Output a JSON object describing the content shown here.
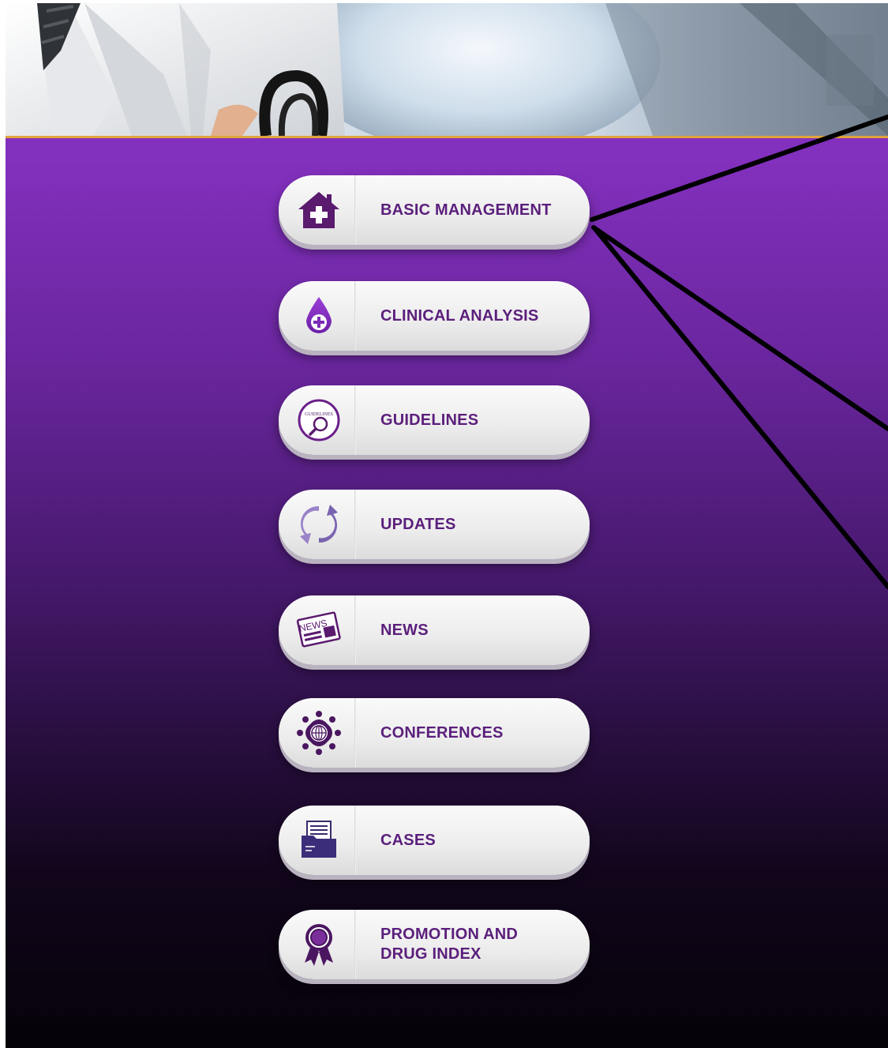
{
  "theme": {
    "accent": "#5b1f7c",
    "background_top": "#8a33c6",
    "background_bottom": "#050208",
    "header_border": "#e0a43a"
  },
  "hero": {
    "image": "doctor-with-stethoscope-photo"
  },
  "menu": {
    "items": [
      {
        "label": "BASIC MANAGEMENT",
        "icon": "house-medical-icon"
      },
      {
        "label": "CLINICAL ANALYSIS",
        "icon": "blood-drop-icon"
      },
      {
        "label": "GUIDELINES",
        "icon": "guidelines-magnifier-icon",
        "icon_text": "GUIDELINES"
      },
      {
        "label": "UPDATES",
        "icon": "refresh-icon"
      },
      {
        "label": "NEWS",
        "icon": "newspaper-icon",
        "icon_text": "NEWS"
      },
      {
        "label": "CONFERENCES",
        "icon": "conference-network-icon"
      },
      {
        "label": "CASES",
        "icon": "folder-documents-icon"
      },
      {
        "label": "PROMOTION AND\nDRUG INDEX",
        "icon": "award-ribbon-icon"
      }
    ]
  }
}
